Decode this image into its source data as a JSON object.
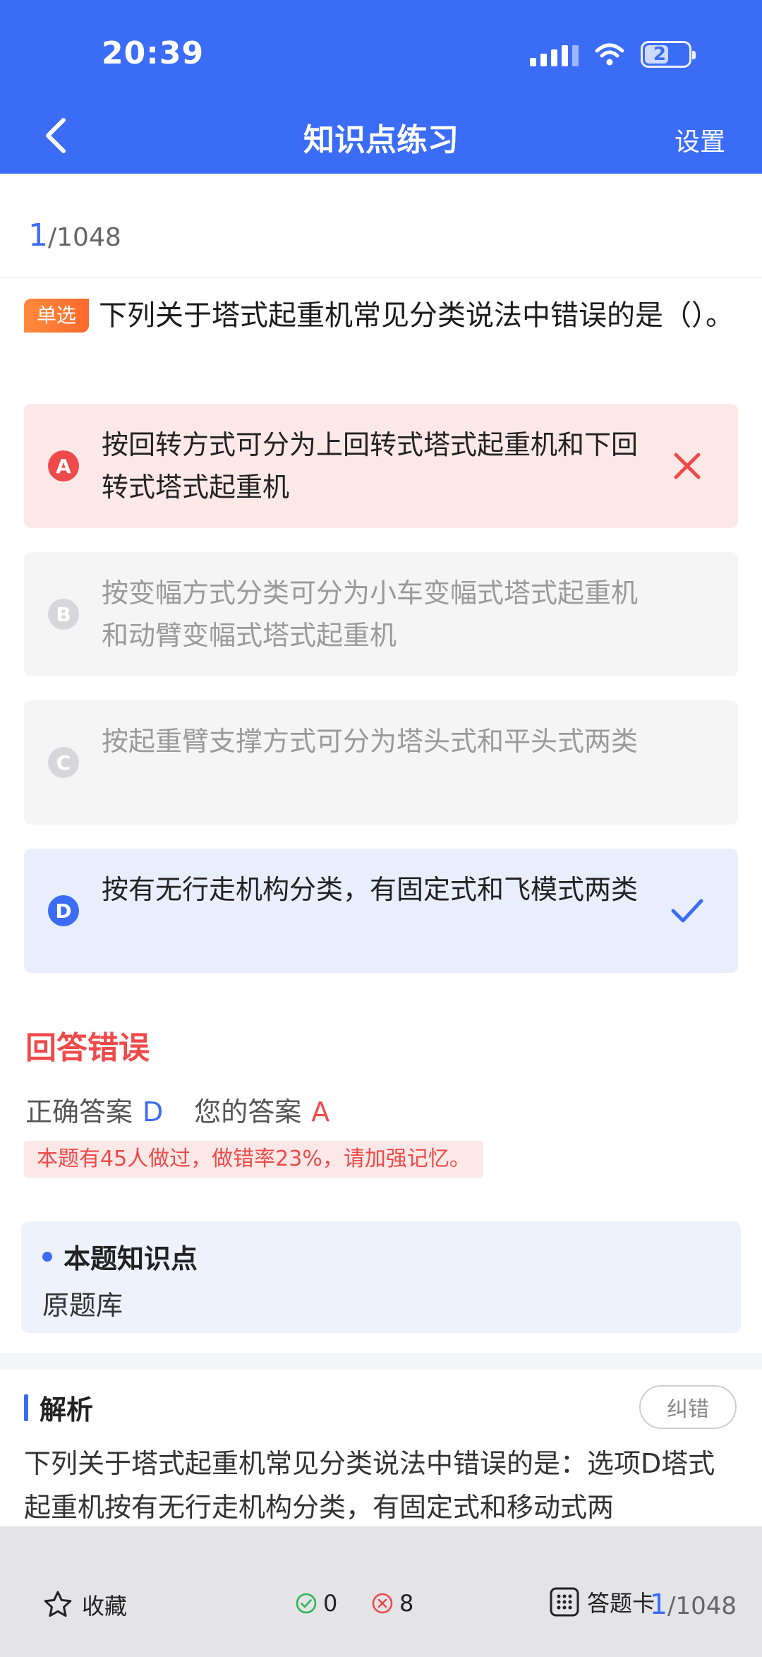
{
  "status_bar": {
    "time": "20:39",
    "battery": "21"
  },
  "nav": {
    "title": "知识点练习",
    "settings_label": "设置"
  },
  "progress": {
    "current": "1",
    "total": "/1048"
  },
  "question": {
    "type_tag": "单选",
    "text": "下列关于塔式起重机常见分类说法中错误的是（）。",
    "options": [
      {
        "letter": "A",
        "text": "按回转方式可分为上回转式塔式起重机和下回转式塔式起重机",
        "state": "wrong"
      },
      {
        "letter": "B",
        "text": "按变幅方式分类可分为小车变幅式塔式起重机和动臂变幅式塔式起重机",
        "state": "neutral"
      },
      {
        "letter": "C",
        "text": "按起重臂支撑方式可分为塔头式和平头式两类",
        "state": "neutral"
      },
      {
        "letter": "D",
        "text": "按有无行走机构分类，有固定式和飞模式两类",
        "state": "correct"
      }
    ]
  },
  "result": {
    "title": "回答错误",
    "correct_label": "正确答案",
    "correct_value": "D",
    "yours_label": "您的答案",
    "yours_value": "A",
    "stat_note": "本题有45人做过，做错率23%，请加强记忆。"
  },
  "knowledge_point": {
    "title": "本题知识点",
    "value": "原题库"
  },
  "analysis": {
    "title": "解析",
    "report_label": "纠错",
    "text": "下列关于塔式起重机常见分类说法中错误的是：选项D塔式起重机按有无行走机构分类，有固定式和移动式两"
  },
  "bottom_bar": {
    "favorite_label": "收藏",
    "right_count": "0",
    "wrong_count": "8",
    "card_label": "答题卡",
    "current": "1",
    "total": "/1048"
  },
  "colors": {
    "primary": "#3b6cf6",
    "error": "#ef4a4a",
    "tag": "#ff7a35"
  },
  "icons": [
    "back-arrow-icon",
    "signal-icon",
    "wifi-icon",
    "battery-icon",
    "wrong-x-icon",
    "check-icon",
    "star-icon",
    "right-count-icon",
    "wrong-count-icon",
    "answer-card-icon"
  ]
}
